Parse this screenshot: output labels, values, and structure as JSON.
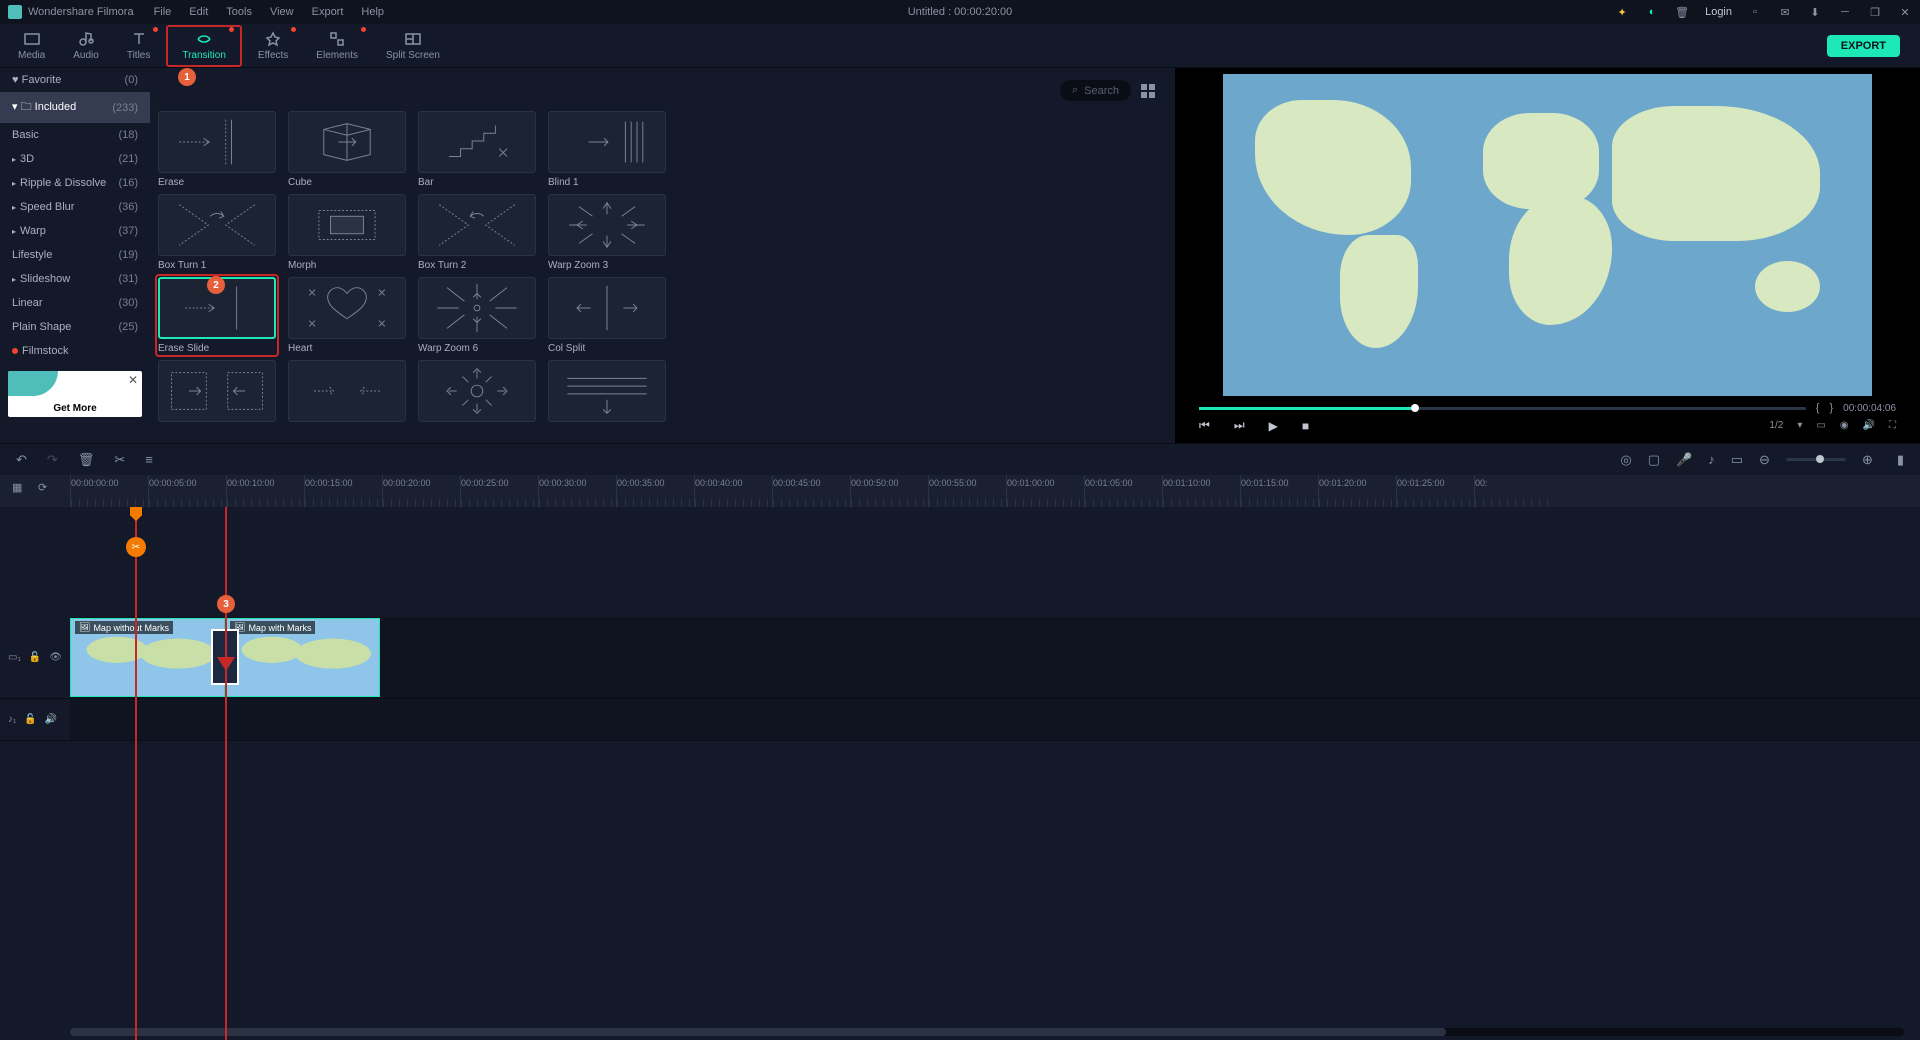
{
  "app": {
    "name": "Wondershare Filmora",
    "title": "Untitled : 00:00:20:00"
  },
  "menu": [
    "File",
    "Edit",
    "Tools",
    "View",
    "Export",
    "Help"
  ],
  "titlebar_right": {
    "login": "Login"
  },
  "tabs": [
    {
      "id": "media",
      "label": "Media",
      "dot": false
    },
    {
      "id": "audio",
      "label": "Audio",
      "dot": false
    },
    {
      "id": "titles",
      "label": "Titles",
      "dot": true
    },
    {
      "id": "transition",
      "label": "Transition",
      "dot": true,
      "active": true
    },
    {
      "id": "effects",
      "label": "Effects",
      "dot": true
    },
    {
      "id": "elements",
      "label": "Elements",
      "dot": true
    },
    {
      "id": "splitscreen",
      "label": "Split Screen",
      "dot": false
    }
  ],
  "export_label": "EXPORT",
  "sidebar": {
    "favorite": {
      "label": "Favorite",
      "count": "(0)"
    },
    "included": {
      "label": "Included",
      "count": "(233)"
    },
    "items": [
      {
        "label": "Basic",
        "count": "(18)",
        "arrow": false
      },
      {
        "label": "3D",
        "count": "(21)",
        "arrow": true
      },
      {
        "label": "Ripple & Dissolve",
        "count": "(16)",
        "arrow": true
      },
      {
        "label": "Speed Blur",
        "count": "(36)",
        "arrow": true
      },
      {
        "label": "Warp",
        "count": "(37)",
        "arrow": true
      },
      {
        "label": "Lifestyle",
        "count": "(19)",
        "arrow": false
      },
      {
        "label": "Slideshow",
        "count": "(31)",
        "arrow": true
      },
      {
        "label": "Linear",
        "count": "(30)",
        "arrow": false
      },
      {
        "label": "Plain Shape",
        "count": "(25)",
        "arrow": false
      }
    ],
    "filmstock": "Filmstock",
    "promo": "Get More"
  },
  "search_placeholder": "Search",
  "transitions": [
    [
      {
        "name": "Erase"
      },
      {
        "name": "Cube"
      },
      {
        "name": "Bar"
      },
      {
        "name": "Blind 1"
      }
    ],
    [
      {
        "name": "Box Turn 1"
      },
      {
        "name": "Morph"
      },
      {
        "name": "Box Turn 2"
      },
      {
        "name": "Warp Zoom 3"
      }
    ],
    [
      {
        "name": "Erase Slide",
        "selected": true,
        "highlighted": true
      },
      {
        "name": "Heart"
      },
      {
        "name": "Warp Zoom 6"
      },
      {
        "name": "Col Split"
      }
    ],
    [
      {
        "name": ""
      },
      {
        "name": ""
      },
      {
        "name": ""
      },
      {
        "name": ""
      }
    ]
  ],
  "preview": {
    "time": "00:00:04:06",
    "playback_quality": "1/2"
  },
  "ruler": [
    "00:00:00:00",
    "00:00:05:00",
    "00:00:10:00",
    "00:00:15:00",
    "00:00:20:00",
    "00:00:25:00",
    "00:00:30:00",
    "00:00:35:00",
    "00:00:40:00",
    "00:00:45:00",
    "00:00:50:00",
    "00:00:55:00",
    "00:01:00:00",
    "00:01:05:00",
    "00:01:10:00",
    "00:01:15:00",
    "00:01:20:00",
    "00:01:25:00",
    "00:"
  ],
  "clips": [
    {
      "label": "Map without Marks"
    },
    {
      "label": "Map with Marks"
    }
  ],
  "badges": {
    "b1": "1",
    "b2": "2",
    "b3": "3"
  },
  "tracks": {
    "video": "",
    "audio": ""
  }
}
